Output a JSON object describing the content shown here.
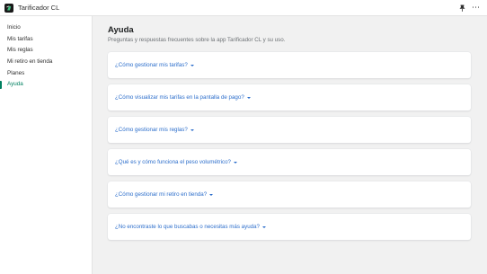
{
  "app": {
    "name": "Tarificador CL",
    "icons": {
      "logo": "app-logo-icon",
      "pin": "pin-icon",
      "more": "more-icon"
    },
    "colors": {
      "accent": "#008060",
      "link": "#2c6ecb"
    }
  },
  "sidebar": {
    "items": [
      {
        "label": "Inicio",
        "active": false
      },
      {
        "label": "Mis tarifas",
        "active": false
      },
      {
        "label": "Mis reglas",
        "active": false
      },
      {
        "label": "Mi retiro en tienda",
        "active": false
      },
      {
        "label": "Planes",
        "active": false
      },
      {
        "label": "Ayuda",
        "active": true
      }
    ]
  },
  "main": {
    "title": "Ayuda",
    "subtitle": "Preguntas y respuestas frecuentes sobre la app Tarificador CL y su uso.",
    "faqs": [
      {
        "question": "¿Cómo gestionar mis tarifas?"
      },
      {
        "question": "¿Cómo visualizar mis tarifas en la pantalla de pago?"
      },
      {
        "question": "¿Cómo gestionar mis reglas?"
      },
      {
        "question": "¿Qué es y cómo funciona el peso volumétrico?"
      },
      {
        "question": "¿Cómo gestionar mi retiro en tienda?"
      },
      {
        "question": "¿No encontraste lo que buscabas o necesitas más ayuda?"
      }
    ]
  }
}
